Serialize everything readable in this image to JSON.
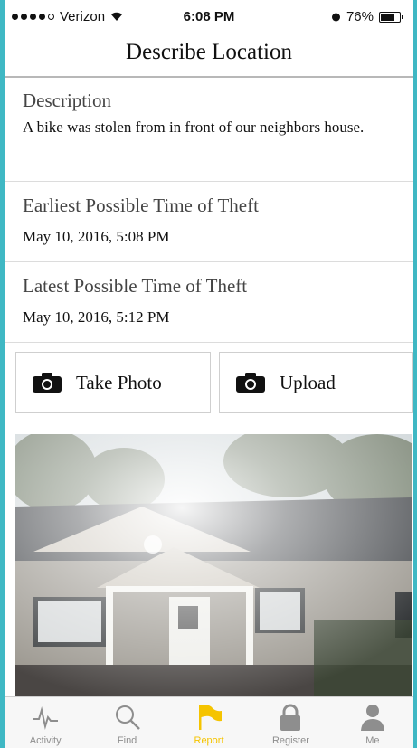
{
  "status_bar": {
    "carrier": "Verizon",
    "time": "6:08 PM",
    "battery": "76%",
    "battery_level": 0.76
  },
  "nav": {
    "title": "Describe Location"
  },
  "description": {
    "label": "Description",
    "value": "A bike was stolen from in front of our neighbors house."
  },
  "earliest": {
    "label": "Earliest Possible Time of Theft",
    "value": "May 10, 2016, 5:08 PM"
  },
  "latest": {
    "label": "Latest Possible Time of Theft",
    "value": "May 10, 2016, 5:12 PM"
  },
  "actions": {
    "take_photo": "Take Photo",
    "upload": "Upload"
  },
  "tabs": [
    {
      "label": "Activity",
      "icon": "activity-icon",
      "active": false
    },
    {
      "label": "Find",
      "icon": "search-icon",
      "active": false
    },
    {
      "label": "Report",
      "icon": "flag-icon",
      "active": true
    },
    {
      "label": "Register",
      "icon": "lock-icon",
      "active": false
    },
    {
      "label": "Me",
      "icon": "person-icon",
      "active": false
    }
  ],
  "colors": {
    "frame": "#3fb8c4",
    "active_tab": "#f5c400",
    "inactive_tab": "#8e8e8e"
  }
}
